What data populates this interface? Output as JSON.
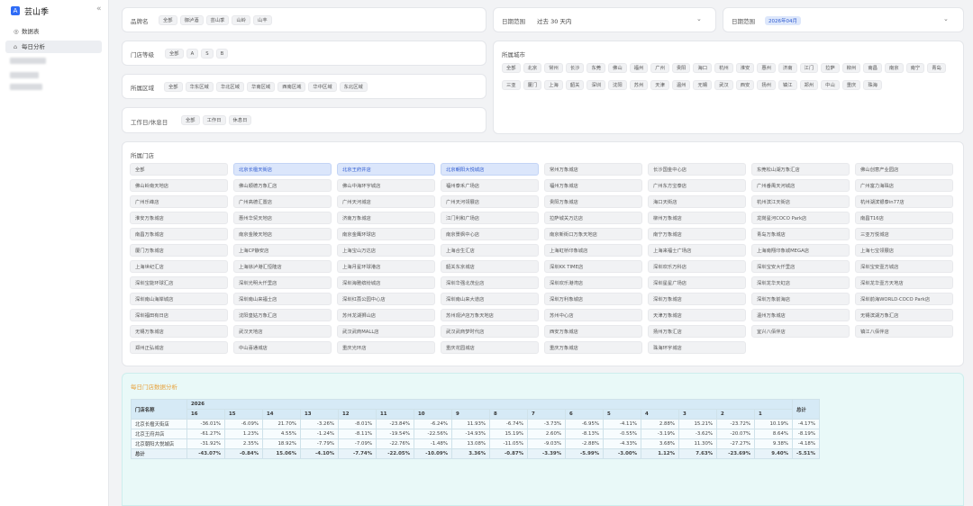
{
  "app": {
    "logo": "A",
    "name": "芸山季",
    "collapse": "«"
  },
  "menu": [
    {
      "icon": "◎",
      "label": "数据表"
    },
    {
      "icon": "⌂",
      "label": "每日分析"
    }
  ],
  "filters": {
    "brand": {
      "label": "品牌名",
      "options": [
        "全部",
        "御泸酒",
        "芸山季",
        "山岭",
        "山丰"
      ]
    },
    "level": {
      "label": "门店等级",
      "options": [
        "全部",
        "A",
        "S",
        "B"
      ]
    },
    "region": {
      "label": "所属区域",
      "options": [
        "全部",
        "华东区域",
        "华北区域",
        "华南区域",
        "西南区域",
        "华中区域",
        "东北区域"
      ]
    },
    "workday": {
      "label": "工作日/休息日",
      "options": [
        "全部",
        "工作日",
        "休息日"
      ]
    },
    "date_range1": {
      "label": "日期范围",
      "value": "过去 30 天内"
    },
    "date_range2": {
      "label": "日期范围",
      "tag": "2026年04月"
    },
    "city": {
      "label": "所属城市",
      "options": [
        "全部",
        "北京",
        "常州",
        "长沙",
        "东莞",
        "佛山",
        "福州",
        "广州",
        "贵阳",
        "海口",
        "杭州",
        "淮安",
        "惠州",
        "济南",
        "江门",
        "拉萨",
        "柳州",
        "南昌",
        "南京",
        "南宁",
        "青岛",
        "三亚",
        "厦门",
        "上海",
        "韶关",
        "深圳",
        "沈阳",
        "苏州",
        "天津",
        "温州",
        "无锡",
        "武汉",
        "西安",
        "扬州",
        "镇江",
        "郑州",
        "中山",
        "重庆",
        "珠海"
      ]
    },
    "store": {
      "label": "所属门店",
      "selected": [
        1,
        2,
        3
      ],
      "options": [
        "全部",
        "北京长楹天街店",
        "北京王府井店",
        "北京朝阳大悦城店",
        "常州万象城店",
        "长沙国金中心店",
        "东莞松山湖万象汇店",
        "佛山创意产业园店",
        "佛山岭南天地店",
        "佛山顺德万象汇店",
        "佛山中海环宇城店",
        "福州泰禾广场店",
        "福州万象城店",
        "广州东方宝泰店",
        "广州番禺天河城店",
        "广州富力海珠店",
        "广州乐峰店",
        "广州高德汇置店",
        "广州天河城店",
        "广州天河领展店",
        "贵阳万象城店",
        "海口天街店",
        "杭州滨江天街店",
        "杭州湖滨银泰in77店",
        "淮安万象城店",
        "惠州华贸天地店",
        "济南万象城店",
        "江门利和广场店",
        "拉萨城关万达店",
        "柳州万象城店",
        "龙岗星河COCO Park店",
        "南昌T16店",
        "南昌万象城店",
        "南京金陵天地店",
        "南京金鹰环球店",
        "南京景枫中心店",
        "南京新街口万象天地店",
        "南宁万象城店",
        "青岛万象城店",
        "三亚万悦城店",
        "厦门万象城店",
        "上海CP静安店",
        "上海宝山万达店",
        "上海合生汇店",
        "上海虹桥印象城店",
        "上海来福士广场店",
        "上海南翔印象城MEGA店",
        "上海七宝领展店",
        "上海世纪汇店",
        "上海徐泸港汇恒隆店",
        "上海月星环球港店",
        "韶关东京城店",
        "深圳KK TIME店",
        "深圳欢乐万科店",
        "深圳宝安大仟里店",
        "深圳宝安壹方城店",
        "深圳宝能环球汇店",
        "深圳光明大仟里店",
        "深圳海雅缤纷城店",
        "深圳华强北茂业店",
        "深圳欢乐港湾店",
        "深圳星星广场店",
        "深圳龙华天虹店",
        "深圳龙华壹方天地店",
        "深圳南山海岸城店",
        "深圳南山来福士店",
        "深圳红荔公园中心店",
        "深圳南山来大道店",
        "深圳万利象城店",
        "深圳万象城店",
        "深圳万象前海店",
        "深圳前海WORLD·COCO Park店",
        "深圳福田有日店",
        "沈阳皇姑万象汇店",
        "苏州龙湖狮山店",
        "苏州观泸店万象天地店",
        "苏州中心店",
        "天津万象城店",
        "温州万象城店",
        "无锡滨湖万象汇店",
        "无锡万象城店",
        "武汉天地店",
        "武汉武商MALL店",
        "武汉武商梦时代店",
        "西安万象城店",
        "扬州万象汇店",
        "宜兴八佰伴店",
        "镇江八佰伴店",
        "郑州正弘城店",
        "中山喜通城店",
        "重庆光环店",
        "重庆花园城店",
        "重庆万象城店",
        "珠海环宇城店"
      ]
    }
  },
  "analysis": {
    "title": "每日门店数据分析",
    "col_name": "门店名称",
    "year": "2026",
    "total_col": "总计",
    "days": [
      "16",
      "15",
      "14",
      "13",
      "12",
      "11",
      "10",
      "9",
      "8",
      "7",
      "6",
      "5",
      "4",
      "3",
      "2",
      "1"
    ],
    "rows": [
      {
        "name": "北京长楹天街店",
        "values": [
          "-36.01%",
          "-6.09%",
          "21.70%",
          "-3.26%",
          "-8.01%",
          "-23.84%",
          "-6.24%",
          "11.93%",
          "-6.74%",
          "-3.73%",
          "-6.95%",
          "-4.11%",
          "2.88%",
          "15.21%",
          "-23.72%",
          "10.19%"
        ],
        "total": "-4.17%"
      },
      {
        "name": "北京王府井店",
        "values": [
          "-61.27%",
          "1.23%",
          "4.55%",
          "-1.24%",
          "-8.11%",
          "-19.54%",
          "-22.56%",
          "-14.93%",
          "15.19%",
          "2.60%",
          "-8.13%",
          "-0.55%",
          "-3.19%",
          "-3.62%",
          "-20.07%",
          "8.64%"
        ],
        "total": "-8.19%"
      },
      {
        "name": "北京朝阳大悦城店",
        "values": [
          "-31.92%",
          "2.35%",
          "18.92%",
          "-7.79%",
          "-7.09%",
          "-22.76%",
          "-1.48%",
          "13.08%",
          "-11.05%",
          "-9.03%",
          "-2.88%",
          "-4.33%",
          "3.68%",
          "11.30%",
          "-27.27%",
          "9.38%"
        ],
        "total": "-4.18%"
      }
    ],
    "total_row": {
      "name": "总计",
      "values": [
        "-43.07%",
        "-0.84%",
        "15.06%",
        "-4.10%",
        "-7.74%",
        "-22.05%",
        "-10.09%",
        "3.36%",
        "-0.87%",
        "-3.39%",
        "-5.99%",
        "-3.00%",
        "1.12%",
        "7.63%",
        "-23.69%",
        "9.40%"
      ],
      "total": "-5.51%"
    }
  }
}
